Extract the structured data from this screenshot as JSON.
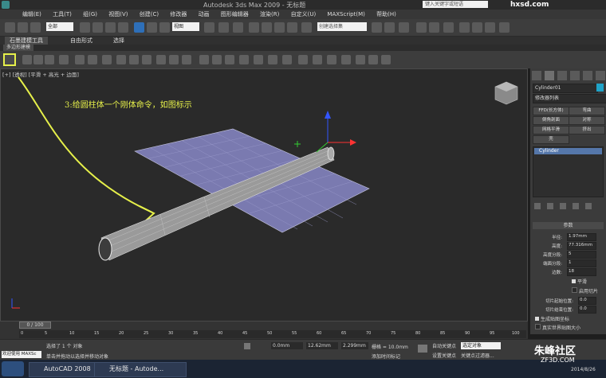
{
  "window": {
    "title": "Autodesk 3ds Max 2009 - 无标题"
  },
  "search": {
    "placeholder": "键入关键字或短语"
  },
  "menu": [
    "编辑(E)",
    "工具(T)",
    "组(G)",
    "视图(V)",
    "创建(C)",
    "修改器",
    "动画",
    "图形编辑器",
    "渲染(R)",
    "自定义(U)",
    "MAXScript(M)",
    "帮助(H)"
  ],
  "toolbar": {
    "filter": "全部",
    "view": "视图",
    "selection_set": "创建选择集"
  },
  "ribbon_tabs": [
    "石墨建模工具",
    "自由形式",
    "选择"
  ],
  "ribbon_subtab": "多边形建模",
  "viewport": {
    "label": "[+] [透视] [平滑 + 高光 + 边面]",
    "annotation": "3:给圆柱体一个刚体命令，如图标示"
  },
  "command_panel": {
    "object_name": "Cylinder01",
    "modifier_list": "修改器列表",
    "buttons": [
      "FFD(长方体)",
      "弯曲",
      "倒角剖面",
      "对称",
      "网格平滑",
      "挤出",
      "壳"
    ],
    "stack_item": "Cylinder",
    "rollout_title": "参数",
    "params": [
      {
        "label": "半径:",
        "value": "1.97mm"
      },
      {
        "label": "高度:",
        "value": "77.316mm"
      },
      {
        "label": "高度分段:",
        "value": "5"
      },
      {
        "label": "端面分段:",
        "value": "1"
      },
      {
        "label": "边数:",
        "value": "18"
      }
    ],
    "smooth": "平滑",
    "slice_on": "启用切片",
    "slice_from": "切片起始位置:",
    "slice_from_val": "0.0",
    "slice_to": "切片结束位置:",
    "slice_to_val": "0.0",
    "gen_map": "生成贴图坐标",
    "real_world": "真实世界贴图大小"
  },
  "timeline": {
    "frame": "0 / 100",
    "ticks": [
      "0",
      "5",
      "10",
      "15",
      "20",
      "25",
      "30",
      "35",
      "40",
      "45",
      "50",
      "55",
      "60",
      "65",
      "70",
      "75",
      "80",
      "85",
      "90",
      "95",
      "100"
    ]
  },
  "status": {
    "welcome": "欢迎使用 MAXSc",
    "selected": "选择了 1 个 对象",
    "hint": "单击并拖动以选择并移动对象",
    "x": "0.0mm",
    "y": "12.62mm",
    "z": "2.299mm",
    "grid": "栅格 = 10.0mm",
    "auto_key": "自动关键点",
    "set_key": "设置关键点",
    "selected_obj": "选定对象",
    "key_filter": "关键点过滤器...",
    "add_time_tag": "添加时间标记"
  },
  "taskbar": {
    "items": [
      "AutoCAD 2008",
      "无标题 - Autode..."
    ],
    "date": "2014/8/26"
  },
  "watermarks": {
    "top": "hxsd.com",
    "bottom": "ZF3D.COM",
    "bottom_cn": "朱峰社区"
  }
}
